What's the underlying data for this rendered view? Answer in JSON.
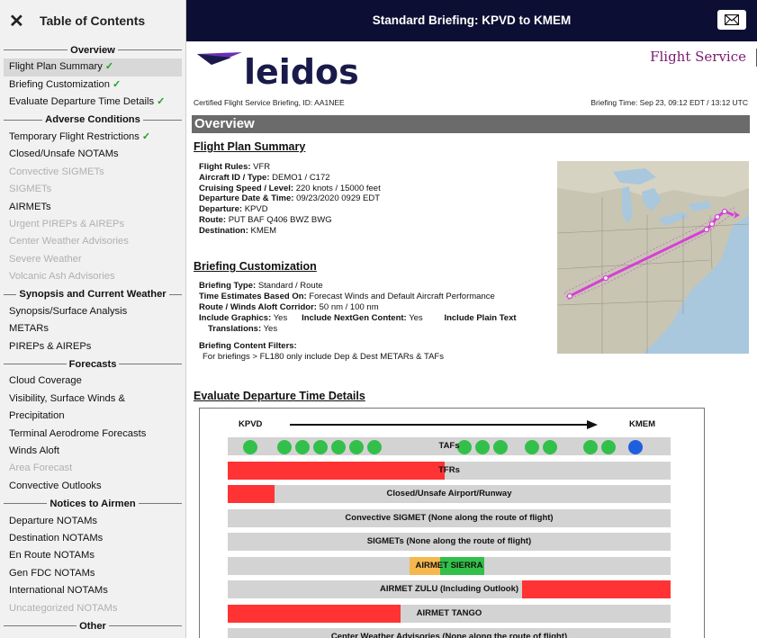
{
  "sidebar": {
    "close_icon": "close-icon",
    "title": "Table of Contents",
    "entries": [
      {
        "type": "section",
        "label": "Overview"
      },
      {
        "type": "item",
        "label": "Flight Plan Summary",
        "check": true,
        "active": true
      },
      {
        "type": "item",
        "label": "Briefing Customization",
        "check": true
      },
      {
        "type": "item",
        "label": "Evaluate Departure Time Details",
        "check": true
      },
      {
        "type": "section",
        "label": "Adverse Conditions"
      },
      {
        "type": "item",
        "label": "Temporary Flight Restrictions",
        "check": true
      },
      {
        "type": "item",
        "label": "Closed/Unsafe NOTAMs"
      },
      {
        "type": "item",
        "label": "Convective SIGMETs",
        "disabled": true
      },
      {
        "type": "item",
        "label": "SIGMETs",
        "disabled": true
      },
      {
        "type": "item",
        "label": "AIRMETs"
      },
      {
        "type": "item",
        "label": "Urgent PIREPs & AIREPs",
        "disabled": true
      },
      {
        "type": "item",
        "label": "Center Weather Advisories",
        "disabled": true
      },
      {
        "type": "item",
        "label": "Severe Weather",
        "disabled": true
      },
      {
        "type": "item",
        "label": "Volcanic Ash Advisories",
        "disabled": true
      },
      {
        "type": "section",
        "label": "Synopsis and Current Weather"
      },
      {
        "type": "item",
        "label": "Synopsis/Surface Analysis"
      },
      {
        "type": "item",
        "label": "METARs"
      },
      {
        "type": "item",
        "label": "PIREPs & AIREPs"
      },
      {
        "type": "section",
        "label": "Forecasts"
      },
      {
        "type": "item",
        "label": "Cloud Coverage"
      },
      {
        "type": "item",
        "label": "Visibility, Surface Winds &"
      },
      {
        "type": "item",
        "label": "Precipitation"
      },
      {
        "type": "item",
        "label": "Terminal Aerodrome Forecasts"
      },
      {
        "type": "item",
        "label": "Winds Aloft"
      },
      {
        "type": "item",
        "label": "Area Forecast",
        "disabled": true
      },
      {
        "type": "item",
        "label": "Convective Outlooks"
      },
      {
        "type": "section",
        "label": "Notices to Airmen"
      },
      {
        "type": "item",
        "label": "Departure NOTAMs"
      },
      {
        "type": "item",
        "label": "Destination NOTAMs"
      },
      {
        "type": "item",
        "label": "En Route NOTAMs"
      },
      {
        "type": "item",
        "label": "Gen FDC NOTAMs"
      },
      {
        "type": "item",
        "label": "International NOTAMs"
      },
      {
        "type": "item",
        "label": "Uncategorized NOTAMs",
        "disabled": true
      },
      {
        "type": "section",
        "label": "Other"
      }
    ]
  },
  "topbar": {
    "title": "Standard Briefing: KPVD to KMEM",
    "mail_icon": "mail-icon",
    "background": "#0c0f33"
  },
  "header": {
    "logo_text": "leidos",
    "flight_service": "Flight Service",
    "certified": "Certified Flight Service Briefing, ID: AA1NEE",
    "briefing_time": "Briefing Time: Sep 23, 09:12 EDT / 13:12 UTC"
  },
  "overview": {
    "heading": "Overview",
    "flight_plan_heading": "Flight Plan Summary",
    "flight_plan": [
      {
        "k": "Flight Rules:",
        "v": "VFR"
      },
      {
        "k": "Aircraft ID / Type:",
        "v": "DEMO1 / C172"
      },
      {
        "k": "Cruising Speed / Level:",
        "v": "220 knots / 15000 feet"
      },
      {
        "k": "Departure Date & Time:",
        "v": "09/23/2020 0929 EDT"
      },
      {
        "k": "Departure:",
        "v": "KPVD"
      },
      {
        "k": "Route:",
        "v": "PUT BAF Q406 BWZ BWG"
      },
      {
        "k": "Destination:",
        "v": "KMEM"
      }
    ],
    "customization_heading": "Briefing Customization",
    "customization": {
      "briefing_type_k": "Briefing Type:",
      "briefing_type_v": "Standard / Route",
      "time_est_k": "Time Estimates Based On:",
      "time_est_v": "Forecast Winds and Default Aircraft Performance",
      "corridor_k": "Route / Winds Aloft Corridor:",
      "corridor_v": "50 nm / 100 nm",
      "graphics_k": "Include Graphics:",
      "graphics_v": "Yes",
      "nextgen_k": "Include NextGen Content:",
      "nextgen_v": "Yes",
      "plaintext_k": "Include Plain Text",
      "translations_k": "Translations:",
      "translations_v": "Yes",
      "filters_k": "Briefing Content Filters:",
      "filters_v": "For briefings > FL180 only include Dep & Dest METARs & TAFs"
    },
    "evaluate_heading": "Evaluate Departure Time Details"
  },
  "departure_chart": {
    "origin": "KPVD",
    "destination": "KMEM",
    "colors": {
      "green": "#33c04a",
      "blue": "#1e5fe0",
      "red": "#ff3333",
      "orange": "#f5b84e",
      "gray": "#d3d3d3"
    },
    "tafs": {
      "label": "TAFs",
      "dots": [
        "green",
        "green",
        "green",
        "green",
        "green",
        "green",
        "green",
        "green",
        "green",
        "green",
        "green",
        "green",
        "green",
        "green",
        "blue"
      ]
    },
    "rows": [
      {
        "label": "TFRs",
        "segments": [
          {
            "from": 0,
            "to": 0.49,
            "color": "red"
          }
        ]
      },
      {
        "label": "Closed/Unsafe Airport/Runway",
        "segments": [
          {
            "from": 0,
            "to": 0.105,
            "color": "red"
          }
        ]
      },
      {
        "label": "Convective SIGMET (None along the route of flight)",
        "segments": []
      },
      {
        "label": "SIGMETs (None along the route of flight)",
        "segments": []
      },
      {
        "label": "AIRMET SIERRA",
        "segments": [
          {
            "from": 0.41,
            "to": 0.48,
            "color": "orange"
          },
          {
            "from": 0.48,
            "to": 0.58,
            "color": "green"
          }
        ]
      },
      {
        "label": "AIRMET ZULU (Including Outlook)",
        "segments": [
          {
            "from": 0.665,
            "to": 1.0,
            "color": "red"
          }
        ]
      },
      {
        "label": "AIRMET TANGO",
        "segments": [
          {
            "from": 0,
            "to": 0.39,
            "color": "red"
          }
        ]
      },
      {
        "label": "Center Weather Advisories (None along the route of flight)",
        "segments": []
      }
    ]
  }
}
